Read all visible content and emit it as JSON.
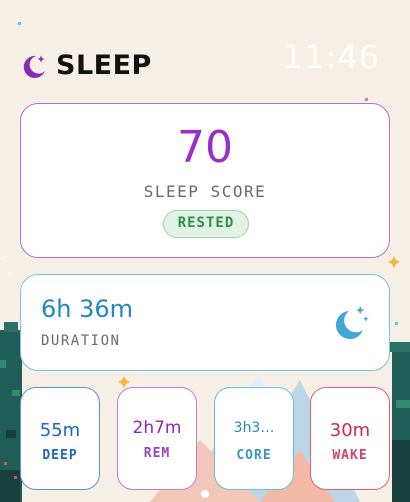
{
  "header": {
    "title": "SLEEP",
    "time": "11:46",
    "icon": "moon-icon"
  },
  "score": {
    "value": "70",
    "label": "SLEEP SCORE",
    "badge": "RESTED"
  },
  "duration": {
    "value": "6h 36m",
    "label": "DURATION",
    "icon": "moon-stars-icon"
  },
  "stages": [
    {
      "value": "55m",
      "label": "DEEP"
    },
    {
      "value": "2h7m",
      "label": "REM"
    },
    {
      "value": "3h3…",
      "label": "CORE"
    },
    {
      "value": "30m",
      "label": "WAKE"
    }
  ],
  "colors": {
    "background": "#f6efe6",
    "score": "#9a2fc6",
    "rested": "#2c8f46",
    "duration": "#2386bf",
    "deep": "#1e66c2",
    "rem": "#8a2ab2",
    "core": "#2b87ad",
    "wake": "#cc2a4e"
  }
}
